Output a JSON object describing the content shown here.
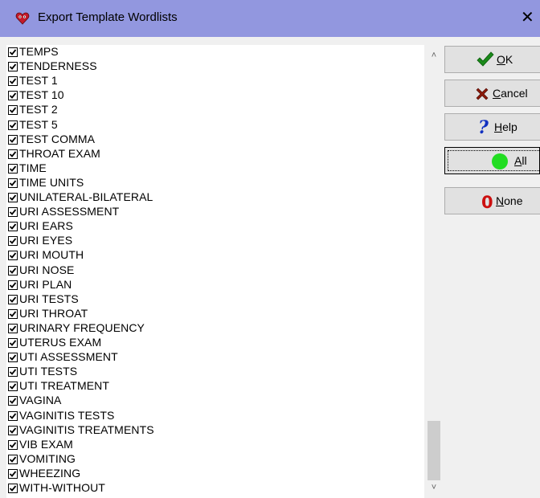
{
  "window": {
    "title": "Export Template Wordlists",
    "close_label": "✕"
  },
  "buttons": {
    "ok": {
      "access_key": "O",
      "rest": "K"
    },
    "cancel": {
      "access_key": "C",
      "rest": "ancel"
    },
    "help": {
      "access_key": "H",
      "rest": "elp"
    },
    "all": {
      "access_key": "A",
      "rest": "ll"
    },
    "none": {
      "access_key": "N",
      "rest": "one"
    }
  },
  "list": {
    "items": [
      {
        "label": "TEMPS",
        "checked": true
      },
      {
        "label": "TENDERNESS",
        "checked": true
      },
      {
        "label": "TEST 1",
        "checked": true
      },
      {
        "label": "TEST 10",
        "checked": true
      },
      {
        "label": "TEST 2",
        "checked": true
      },
      {
        "label": "TEST 5",
        "checked": true
      },
      {
        "label": "TEST COMMA",
        "checked": true
      },
      {
        "label": "THROAT EXAM",
        "checked": true
      },
      {
        "label": "TIME",
        "checked": true
      },
      {
        "label": "TIME UNITS",
        "checked": true
      },
      {
        "label": "UNILATERAL-BILATERAL",
        "checked": true
      },
      {
        "label": "URI ASSESSMENT",
        "checked": true
      },
      {
        "label": "URI EARS",
        "checked": true
      },
      {
        "label": "URI EYES",
        "checked": true
      },
      {
        "label": "URI MOUTH",
        "checked": true
      },
      {
        "label": "URI NOSE",
        "checked": true
      },
      {
        "label": "URI PLAN",
        "checked": true
      },
      {
        "label": "URI TESTS",
        "checked": true
      },
      {
        "label": "URI THROAT",
        "checked": true
      },
      {
        "label": "URINARY FREQUENCY",
        "checked": true
      },
      {
        "label": "UTERUS EXAM",
        "checked": true
      },
      {
        "label": "UTI ASSESSMENT",
        "checked": true
      },
      {
        "label": "UTI TESTS",
        "checked": true
      },
      {
        "label": "UTI TREATMENT",
        "checked": true
      },
      {
        "label": "VAGINA",
        "checked": true
      },
      {
        "label": "VAGINITIS TESTS",
        "checked": true
      },
      {
        "label": "VAGINITIS TREATMENTS",
        "checked": true
      },
      {
        "label": "VIB EXAM",
        "checked": true
      },
      {
        "label": "VOMITING",
        "checked": true
      },
      {
        "label": "WHEEZING",
        "checked": true
      },
      {
        "label": "WITH-WITHOUT",
        "checked": true
      }
    ]
  },
  "scrollbar": {
    "up_arrow": "˄",
    "down_arrow": "˅"
  },
  "colors": {
    "titlebar": "#9297df",
    "ok_check": "#1a8a1a",
    "cancel_x": "#8b1a0a",
    "help_q": "#1030c0",
    "all_dot": "#22dd22",
    "none_zero": "#cc1010"
  }
}
